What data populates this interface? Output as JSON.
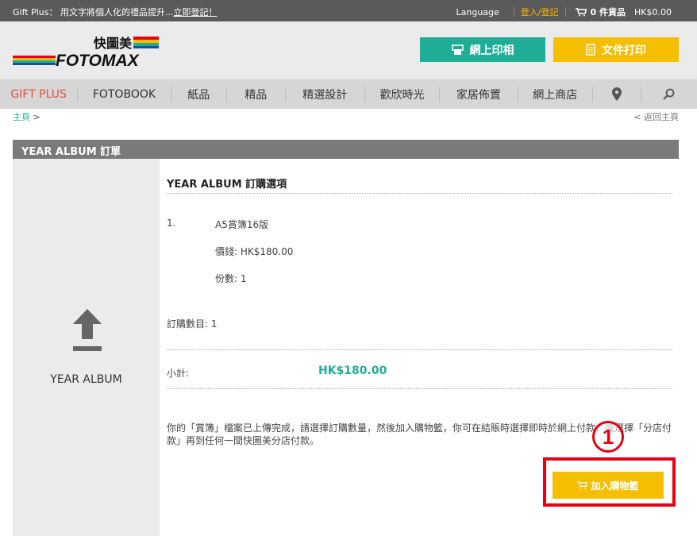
{
  "topbar": {
    "promo_text": "Gift Plus： 用文字將個人化的禮品提升...",
    "promo_link": "立即登記！",
    "language": "Language",
    "login": "登入/登記",
    "cart_count": "0 件貨品",
    "cart_total": "HK$0.00"
  },
  "header": {
    "logo_cn": "快圖美",
    "logo_en": "FOTOMAX",
    "print_button": "網上印相",
    "doc_button": "文件打印"
  },
  "nav": {
    "items": [
      "GIFT PLUS",
      "FOTOBOOK",
      "紙品",
      "精品",
      "精選設計",
      "歡欣時光",
      "家居佈置",
      "網上商店"
    ]
  },
  "breadcrumb": {
    "home": "主頁",
    "arrow": ">",
    "back": "< 返回主頁"
  },
  "order": {
    "panel_title": "YEAR ALBUM 訂單",
    "album_label": "YEAR ALBUM",
    "options_title": "YEAR ALBUM 訂購選項",
    "item_index": "1.",
    "item_name": "A5賞簿16版",
    "item_price": "價錢: HK$180.00",
    "item_qty": "份數: 1",
    "order_count": "訂購數目: 1",
    "subtotal_label": "小計:",
    "subtotal_value": "HK$180.00",
    "notice": "你的「賞簿」檔案已上傳完成，請選擇訂購數量，然後加入購物籃，你可在結賬時選擇即時於網上付款，或選擇「分店付款」再到任何一間快圖美分店付款。",
    "add_to_cart": "加入購物籃"
  },
  "annotation": {
    "step_number": "1"
  },
  "colors": {
    "teal": "#1fae95",
    "yellow": "#f6be00",
    "highlight_red": "#e60012",
    "nav_active": "#e0543c"
  }
}
